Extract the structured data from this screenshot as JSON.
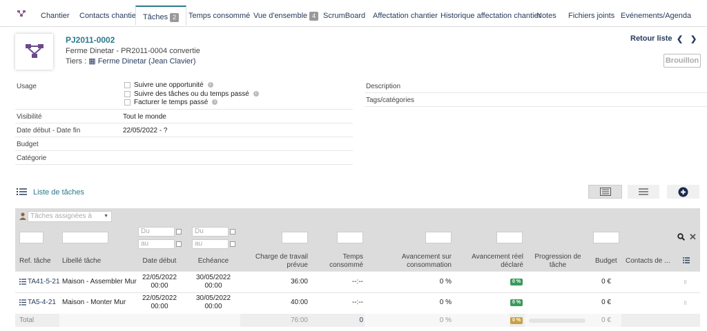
{
  "tabs": [
    {
      "label": "Chantier"
    },
    {
      "label": "Contacts chantier"
    },
    {
      "label": "Tâches",
      "badge": "2"
    },
    {
      "label": "Temps consommé"
    },
    {
      "label": "Vue d'ensemble",
      "badge": "4"
    },
    {
      "label": "ScrumBoard"
    },
    {
      "label": "Affectation chantier"
    },
    {
      "label": "Historique affectation chantier"
    },
    {
      "label": "Notes"
    },
    {
      "label": "Fichiers joints"
    },
    {
      "label": "Evénements/Agenda"
    }
  ],
  "project": {
    "ref": "PJ2011-0002",
    "label": "Ferme Dinetar - PR2011-0004 convertie",
    "tiers_label": "Tiers : ",
    "tiers_value": "Ferme Dinetar (Jean Clavier)",
    "retour": "Retour liste",
    "status": "Brouillon"
  },
  "fields": {
    "usage_label": "Usage",
    "usage_options": [
      "Suivre une opportunité",
      "Suivre des tâches ou du temps passé",
      "Facturer le temps passé"
    ],
    "visibility_label": "Visibilité",
    "visibility_value": "Tout le monde",
    "dates_label": "Date début - Date fin",
    "dates_value": "22/05/2022 - ?",
    "budget_label": "Budget",
    "category_label": "Catégorie",
    "description_label": "Description",
    "tags_label": "Tags/catégories"
  },
  "tasklist": {
    "title": "Liste de tâches",
    "assigned_placeholder": "Tâches assignées à",
    "du_placeholder": "Du",
    "au_placeholder": "au",
    "headers": {
      "ref": "Ref. tâche",
      "label": "Libellé tâche",
      "start": "Date début",
      "end": "Echéance",
      "charge_1": "Charge de travail",
      "charge_2": "prévue",
      "temps_1": "Temps",
      "temps_2": "consommé",
      "avcons_1": "Avancement sur",
      "avcons_2": "consommation",
      "avreel_1": "Avancement réel",
      "avreel_2": "déclaré",
      "prog_1": "Progression de",
      "prog_2": "tâche",
      "budget": "Budget",
      "contacts": "Contacts de ..."
    },
    "rows": [
      {
        "ref": "TA41-5-21",
        "label": "Maison - Assembler Mur",
        "start_1": "22/05/2022",
        "start_2": "00:00",
        "end_1": "30/05/2022",
        "end_2": "00:00",
        "charge": "36:00",
        "temps": "--:--",
        "avcons": "0 %",
        "avreel": "0 %",
        "budget": "0 €"
      },
      {
        "ref": "TA5-4-21",
        "label": "Maison - Monter Mur",
        "start_1": "22/05/2022",
        "start_2": "00:00",
        "end_1": "30/05/2022",
        "end_2": "00:00",
        "charge": "40:00",
        "temps": "--:--",
        "avcons": "0 %",
        "avreel": "0 %",
        "budget": "0 €"
      }
    ],
    "total": {
      "label": "Total",
      "charge": "76:00",
      "temps": "0",
      "avcons": "0 %",
      "avreel": "0 %",
      "budget": "0 €"
    }
  },
  "colors": {
    "accent": "#2a7a8a",
    "pill_green": "#3a9a5c",
    "pill_gold": "#c8a040"
  }
}
